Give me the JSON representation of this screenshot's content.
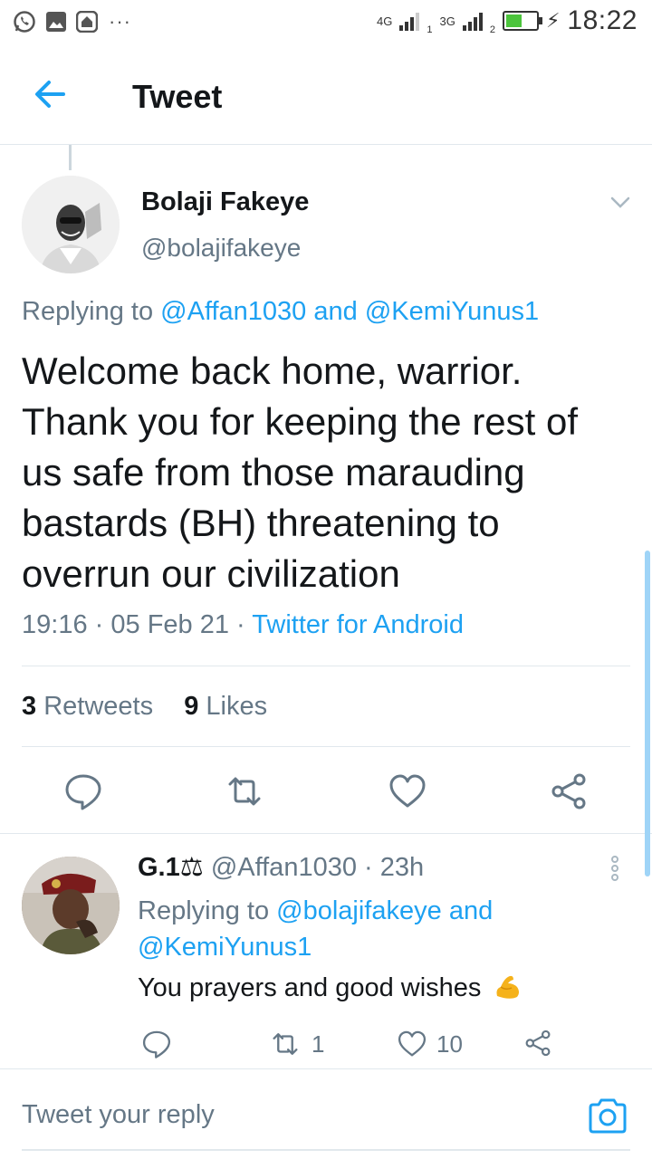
{
  "status_bar": {
    "network_1": "4G",
    "sim_1": "1",
    "network_2": "3G",
    "sim_2": "2",
    "battery_level": 0.55,
    "time": "18:22",
    "left_icons": [
      "whatsapp-icon",
      "gallery-icon",
      "home-icon"
    ],
    "more": "···"
  },
  "header": {
    "title": "Tweet",
    "back_icon": "arrow-left-icon"
  },
  "tweet": {
    "author_name": "Bolaji Fakeye",
    "author_handle": "@bolajifakeye",
    "replying_prefix": "Replying to",
    "replying_to_1": "@Affan1030",
    "replying_and": "and",
    "replying_to_2": "@KemiYunus1",
    "text": "Welcome back home, warrior. Thank you for keeping the rest of us safe from those marauding bastards (BH) threatening to overrun our civilization",
    "time": "19:16",
    "date": "05 Feb 21",
    "separator": "·",
    "source": "Twitter for Android",
    "retweets_count": "3",
    "retweets_label": "Retweets",
    "likes_count": "9",
    "likes_label": "Likes"
  },
  "reply": {
    "name": "G.1⚖",
    "handle": "@Affan1030",
    "separator": "·",
    "time_ago": "23h",
    "replying_prefix": "Replying to",
    "replying_to_1": "@bolajifakeye",
    "replying_and": "and",
    "replying_to_2": "@KemiYunus1",
    "text": "You prayers and good wishes",
    "emoji": "flexed-biceps-emoji",
    "retweet_count": "1",
    "like_count": "10"
  },
  "compose": {
    "placeholder": "Tweet your reply"
  },
  "colors": {
    "accent": "#1da1f2",
    "text": "#14171a",
    "secondary": "#657786",
    "divider": "#e1e8ed",
    "battery": "#4cc43c"
  }
}
